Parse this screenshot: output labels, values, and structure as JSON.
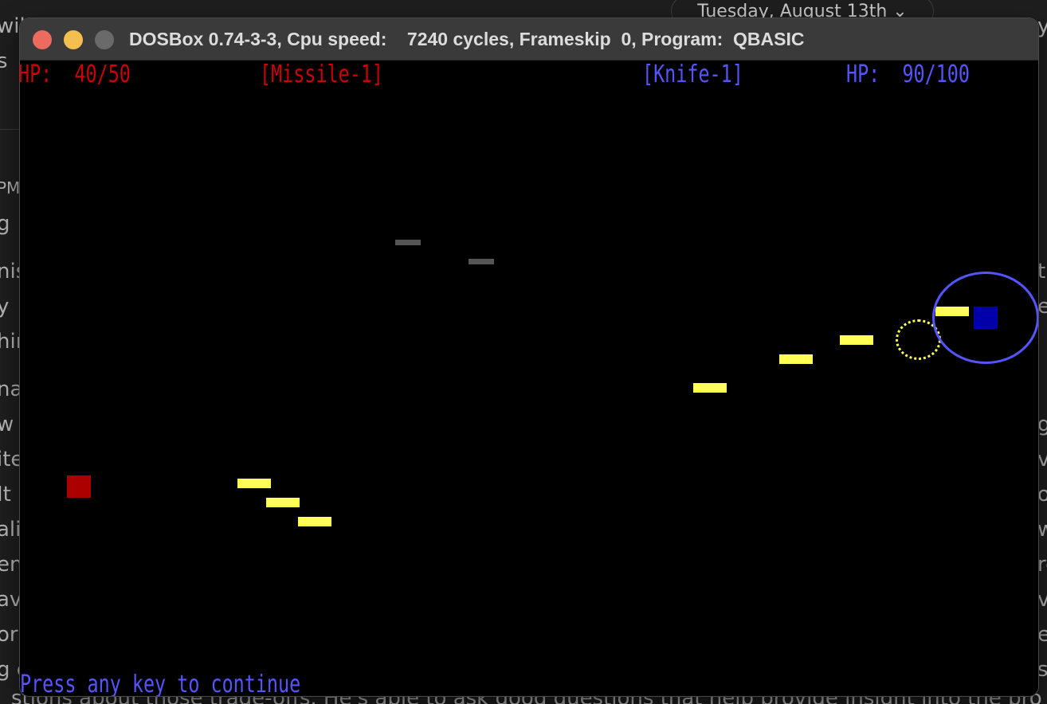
{
  "background": {
    "date_label": "Tuesday, August 13th",
    "date_chevron": "⌄",
    "left_fragments": [
      "wil",
      "s",
      "PM",
      "g",
      "nis",
      "y",
      "hin",
      "na",
      "w",
      "ite",
      "It",
      "ali",
      "ent",
      "av",
      "ork",
      "g c"
    ],
    "right_fragments": [
      "y,",
      "t",
      "e",
      "g",
      "v",
      "o",
      "w",
      "re",
      "v",
      "e",
      "st"
    ],
    "bottom_line": "stions about those trade-offs. He's able to ask good questions that help provide insight into the pro"
  },
  "window": {
    "title": "DOSBox 0.74-3-3, Cpu speed:    7240 cycles, Frameskip  0, Program:  QBASIC",
    "buttons": [
      "close",
      "minimize",
      "maximize"
    ]
  },
  "game": {
    "player1": {
      "hp_text": "HP:  40/50",
      "weapon": "[Missile-1]",
      "color": "#cc0000"
    },
    "player2": {
      "hp_text": "HP:  90/100",
      "weapon": "[Knife-1]",
      "color": "#5555ff"
    },
    "prompt": "Press any key to continue",
    "colors": {
      "p1_body": "#aa0000",
      "p2_body": "#0000aa",
      "projectile": "#ffff55",
      "debris": "#555555",
      "p2_shield": "#5555ff",
      "target_ring": "#ffff55"
    }
  }
}
